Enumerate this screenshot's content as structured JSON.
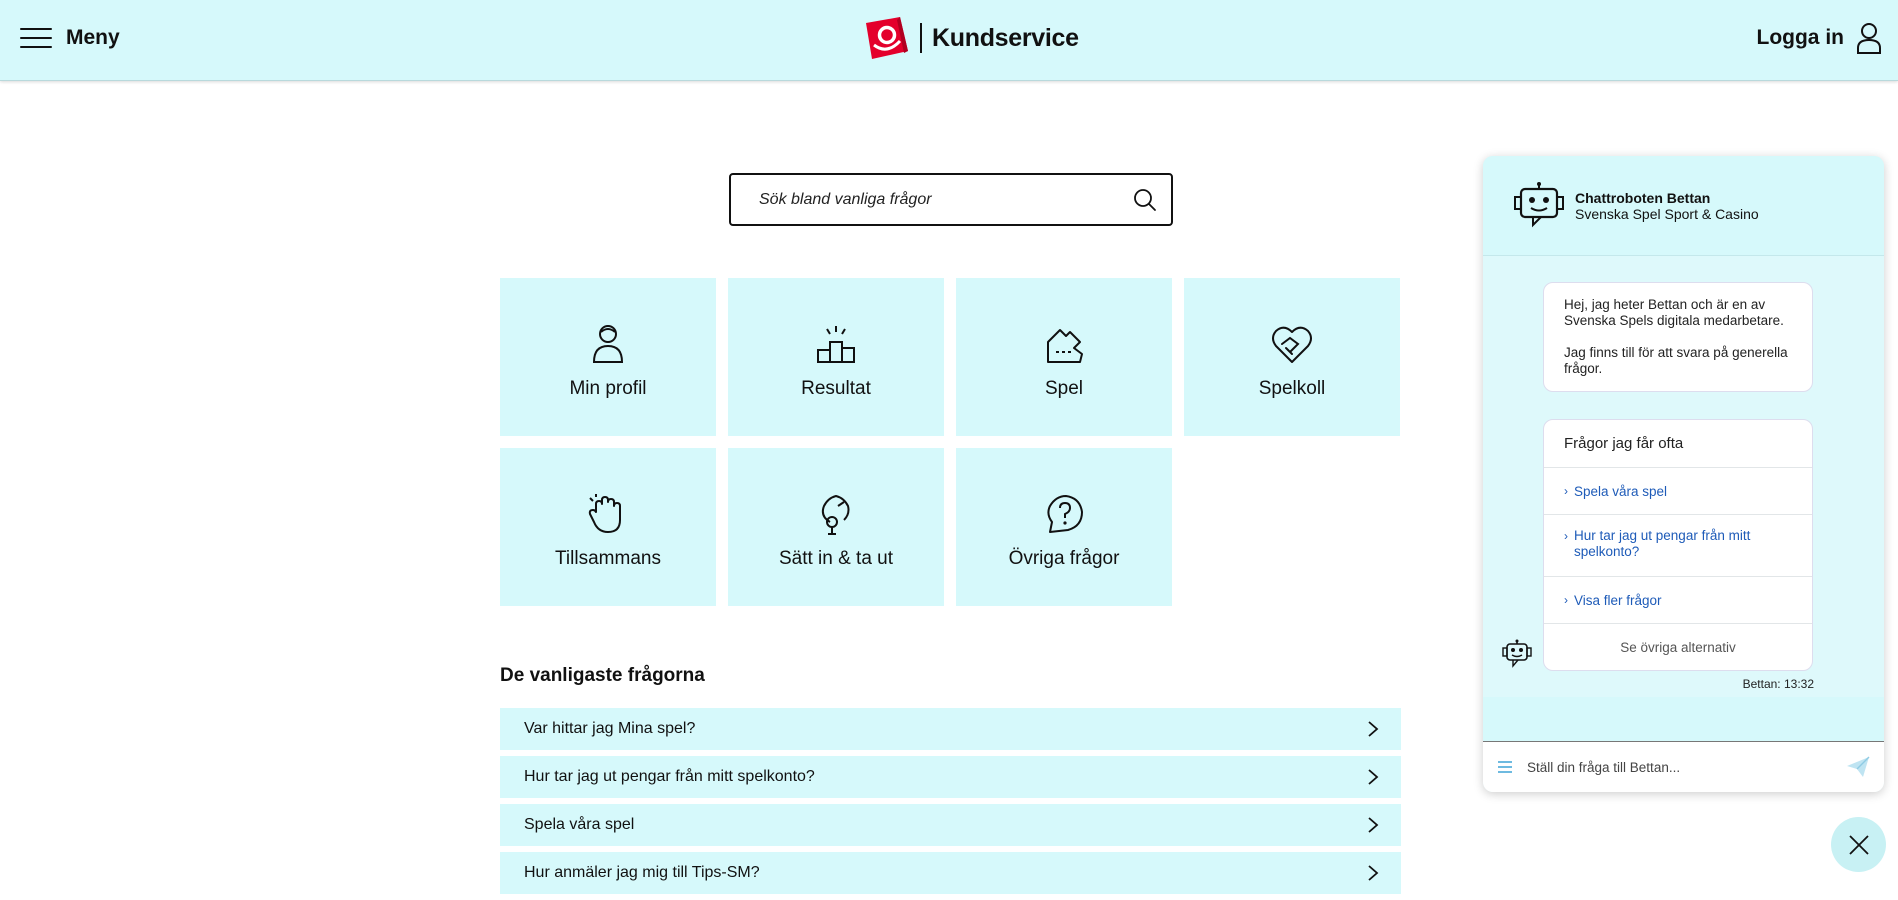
{
  "header": {
    "menu_label": "Meny",
    "title": "Kundservice",
    "login_label": "Logga in"
  },
  "search": {
    "placeholder": "Sök bland vanliga frågor"
  },
  "categories": [
    {
      "label": "Min profil",
      "icon": "person-icon"
    },
    {
      "label": "Resultat",
      "icon": "podium-icon"
    },
    {
      "label": "Spel",
      "icon": "ticket-icon"
    },
    {
      "label": "Spelkoll",
      "icon": "heart-handshake-icon"
    },
    {
      "label": "Tillsammans",
      "icon": "high-five-icon"
    },
    {
      "label": "Sätt in & ta ut",
      "icon": "money-bag-icon"
    },
    {
      "label": "Övriga frågor",
      "icon": "question-bubble-icon"
    }
  ],
  "faq": {
    "title": "De vanligaste frågorna",
    "items": [
      "Var hittar jag Mina spel?",
      "Hur tar jag ut pengar från mitt spelkonto?",
      "Spela våra spel",
      "Hur anmäler jag mig till Tips-SM?"
    ]
  },
  "chat": {
    "bot_name": "Chattroboten Bettan",
    "bot_sub": "Svenska Spel Sport & Casino",
    "greeting_1": "Hej, jag heter Bettan och är en av Svenska Spels digitala medarbetare.",
    "greeting_2": "Jag finns till för att svara på generella frågor.",
    "options_title": "Frågor jag får ofta",
    "options": [
      "Spela våra spel",
      "Hur tar jag ut pengar från mitt spelkonto?",
      "Visa fler frågor"
    ],
    "other_alternatives": "Se övriga alternativ",
    "timestamp": "Bettan: 13:32",
    "input_placeholder": "Ställ din fråga till Bettan..."
  },
  "colors": {
    "accent_bg": "#d6f9fb",
    "link": "#1e5bb8",
    "brand_red": "#e4002b"
  }
}
